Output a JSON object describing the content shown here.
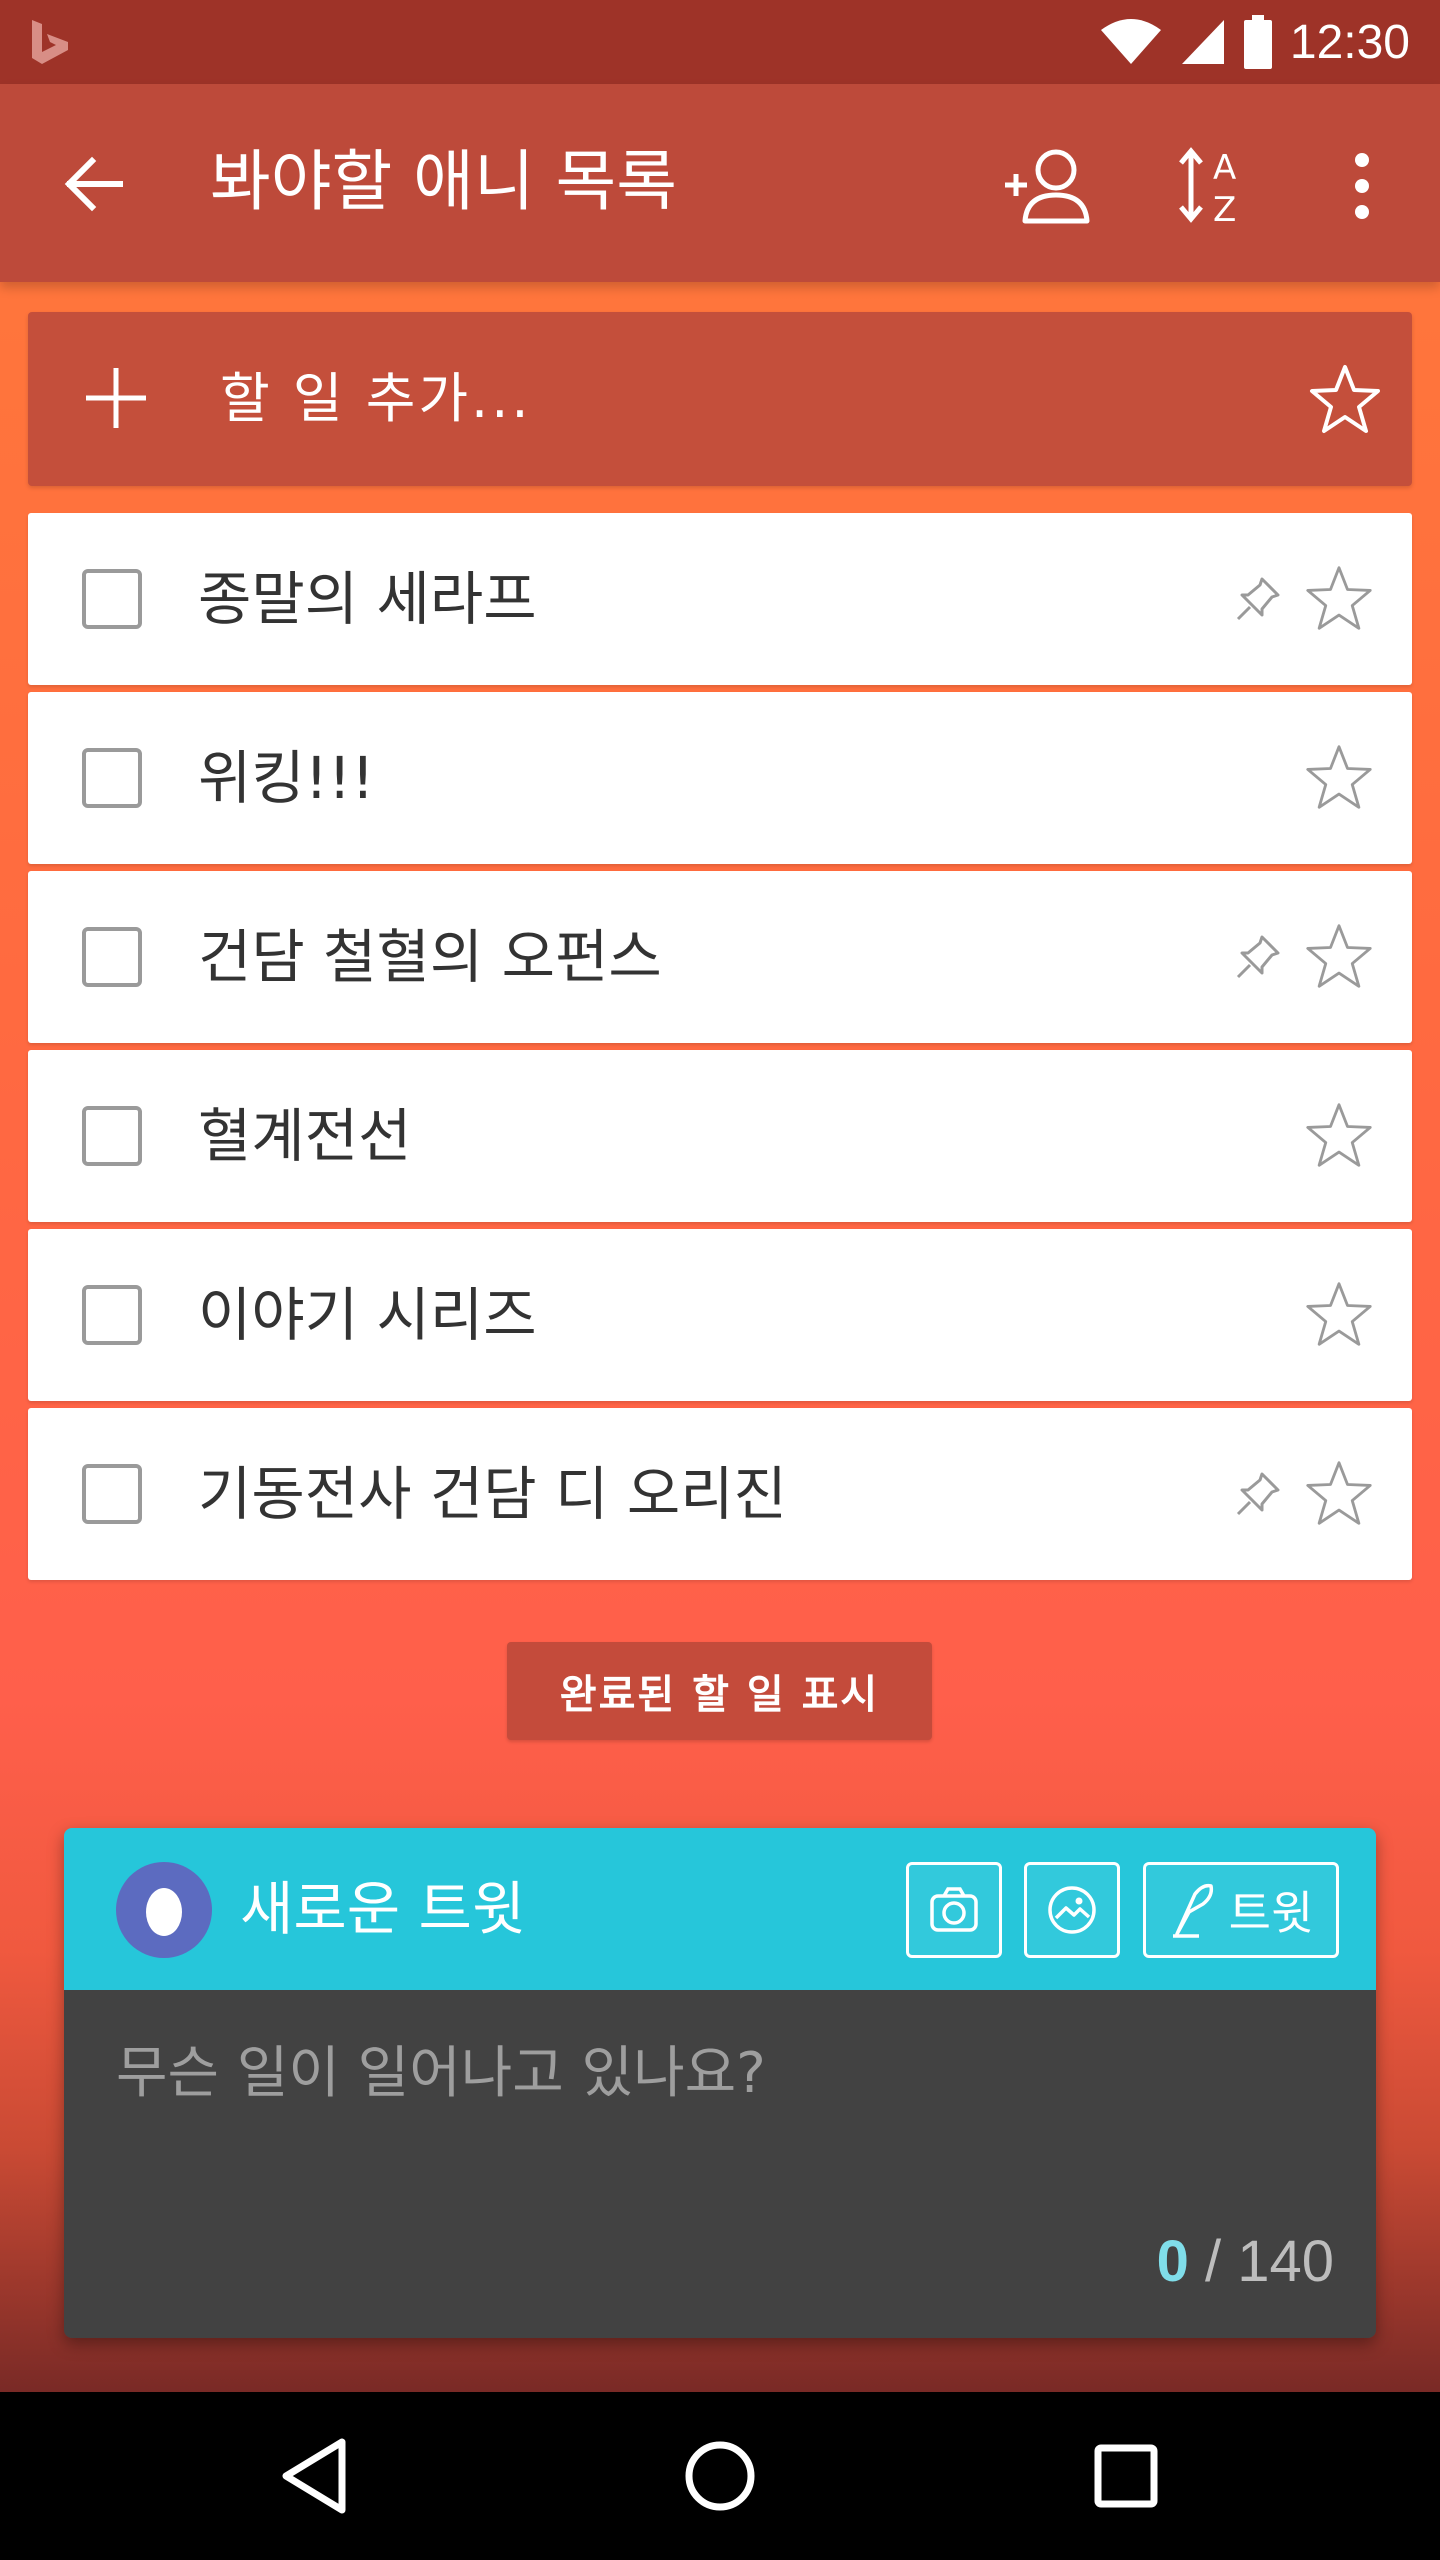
{
  "status_bar": {
    "time": "12:30",
    "icons": [
      "bing-logo-icon",
      "wifi-icon",
      "cell-signal-icon",
      "battery-icon"
    ]
  },
  "app_bar": {
    "title": "봐야할 애니 목록",
    "back_icon": "arrow-back-icon",
    "actions": [
      "add-member-icon",
      "sort-az-icon",
      "more-vert-icon"
    ]
  },
  "add_task": {
    "placeholder": "할 일 추가..."
  },
  "tasks": [
    {
      "title": "종말의 세라프",
      "pinned": true,
      "starred": false
    },
    {
      "title": "위킹!!!",
      "pinned": false,
      "starred": false
    },
    {
      "title": "건담 철혈의 오펀스",
      "pinned": true,
      "starred": false
    },
    {
      "title": "혈계전선",
      "pinned": false,
      "starred": false
    },
    {
      "title": "이야기 시리즈",
      "pinned": false,
      "starred": false
    },
    {
      "title": "기동전사 건담 디 오리진",
      "pinned": true,
      "starred": false
    }
  ],
  "show_completed_label": "완료된 할 일 표시",
  "tweet": {
    "title": "새로운 트윗",
    "tweet_button": "트윗",
    "placeholder": "무슨 일이 일어나고 있나요?",
    "count_current": "0",
    "count_separator": " / ",
    "count_max": "140"
  },
  "colors": {
    "status_bar": "#9e3328",
    "app_bar": "#bd4a3a",
    "tweet_header": "#26c6da",
    "tweet_body": "#424242",
    "counter_accent": "#80deea"
  }
}
